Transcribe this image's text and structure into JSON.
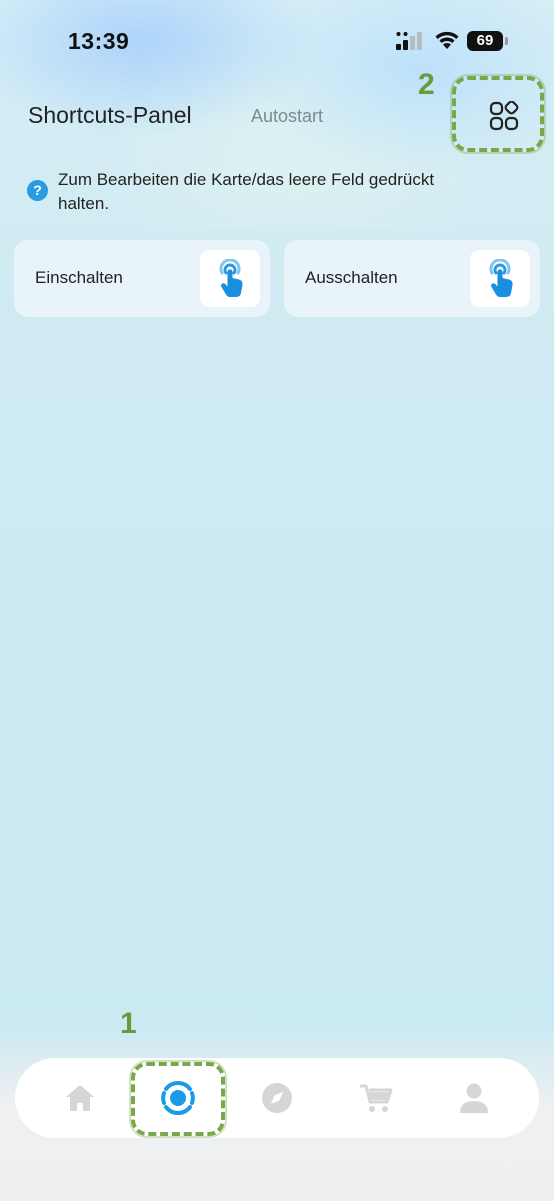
{
  "status_bar": {
    "time": "13:39",
    "battery": "69"
  },
  "header": {
    "title": "Shortcuts-Panel",
    "tab_autostart": "Autostart"
  },
  "hint": {
    "text": "Zum Bearbeiten die Karte/das leere Feld gedrückt halten."
  },
  "shortcuts": [
    {
      "label": "Einschalten",
      "icon": "tap-hand-icon"
    },
    {
      "label": "Ausschalten",
      "icon": "tap-hand-icon"
    }
  ],
  "annotations": {
    "grid_marker": "2",
    "nav_marker": "1"
  },
  "bottom_nav": [
    {
      "icon": "home-icon",
      "active": false
    },
    {
      "icon": "devices-hub-icon",
      "active": true
    },
    {
      "icon": "compass-icon",
      "active": false
    },
    {
      "icon": "cart-icon",
      "active": false
    },
    {
      "icon": "profile-icon",
      "active": false
    }
  ],
  "colors": {
    "accent": "#1a9be6",
    "inactive_icon": "#d4d6d8",
    "annotation": "#6a9a3a"
  }
}
